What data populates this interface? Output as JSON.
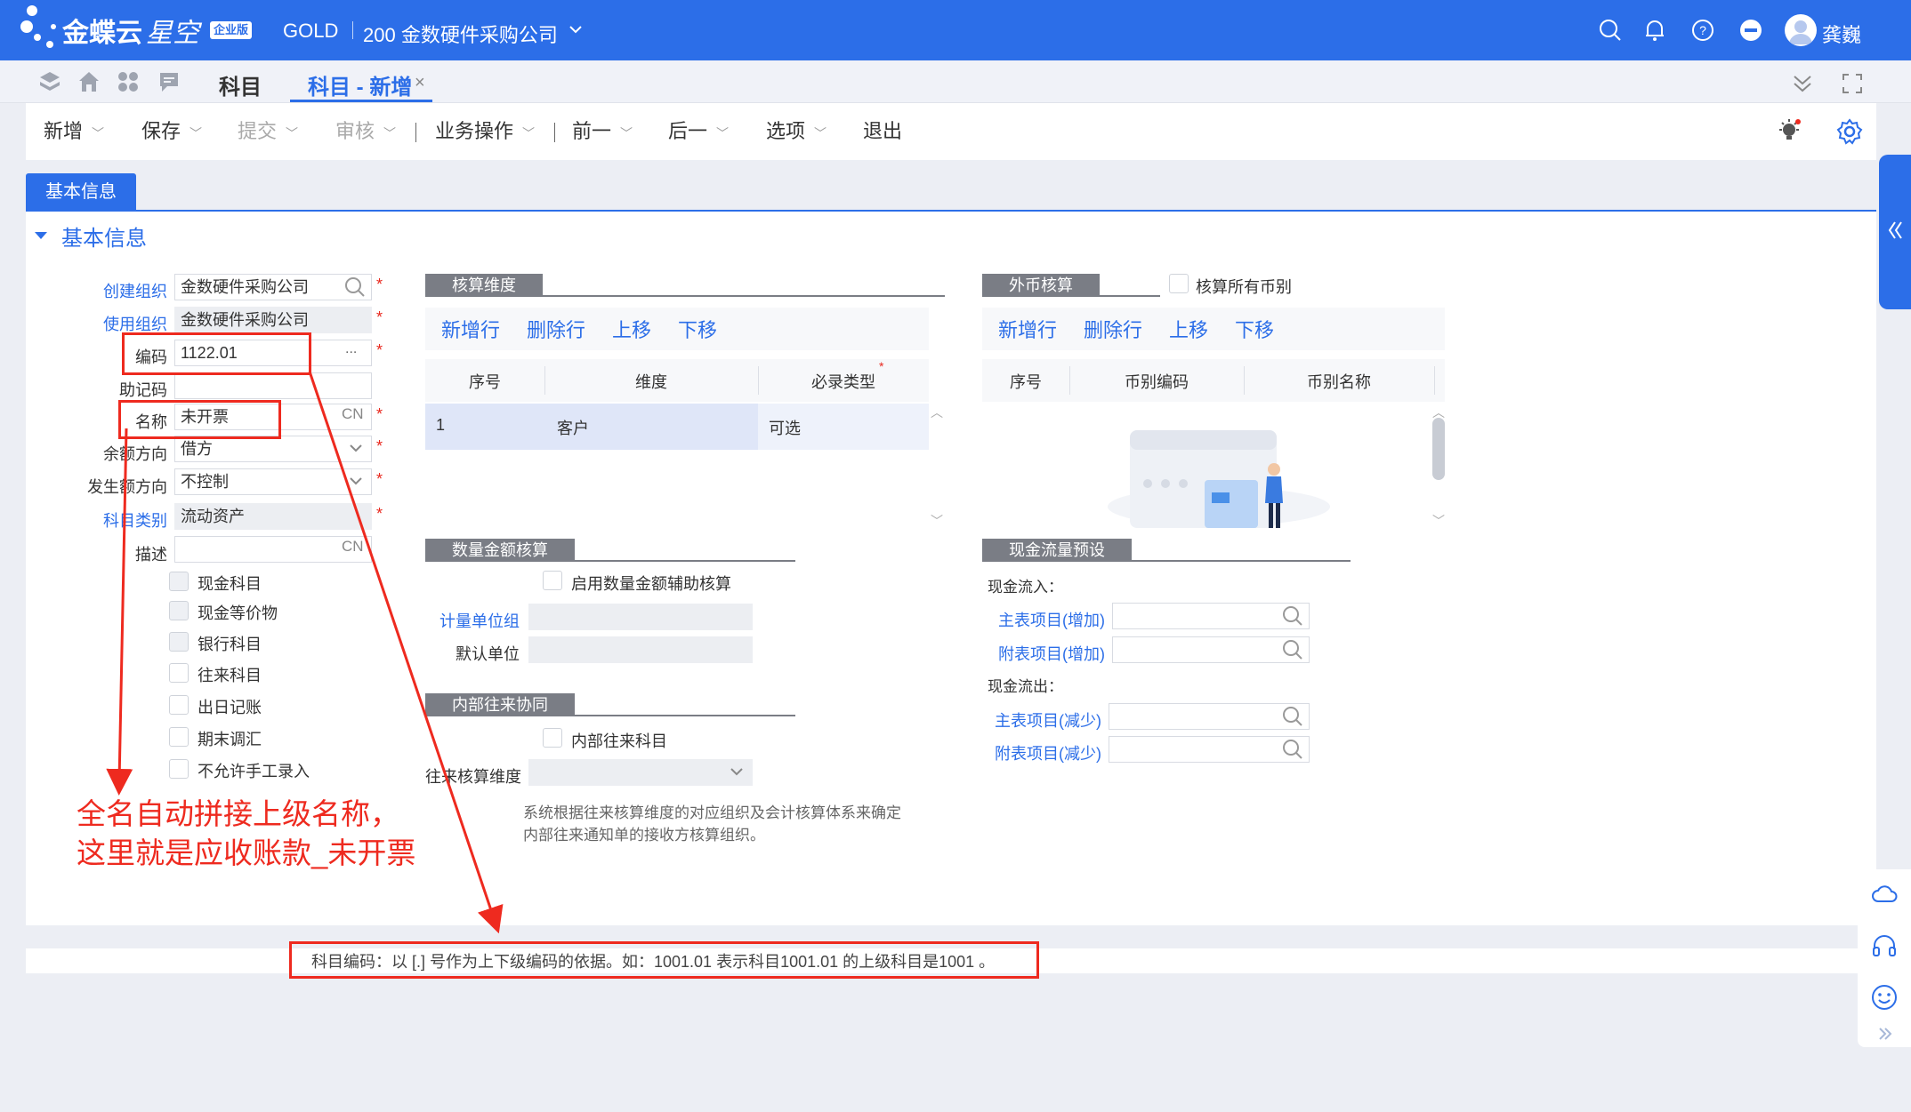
{
  "topbar": {
    "brand": "金蝶云",
    "brand_sub": "星空",
    "edition": "企业版",
    "tenant": "GOLD",
    "org": "200 金数硬件采购公司",
    "user": "龚巍"
  },
  "tabs": {
    "home_tab": "科目",
    "active_tab": "科目 - 新增"
  },
  "toolbar": {
    "new": "新增",
    "save": "保存",
    "submit": "提交",
    "audit": "审核",
    "business": "业务操作",
    "prev": "前一",
    "next": "后一",
    "options": "选项",
    "exit": "退出"
  },
  "form": {
    "tab_label": "基本信息",
    "section_title": "基本信息",
    "create_org_label": "创建组织",
    "create_org_value": "金数硬件采购公司",
    "use_org_label": "使用组织",
    "use_org_value": "金数硬件采购公司",
    "code_label": "编码",
    "code_value": "1122.01",
    "code_more": "...",
    "mnemonic_label": "助记码",
    "name_label": "名称",
    "name_value": "未开票",
    "lang_tag": "CN",
    "balance_dir_label": "余额方向",
    "balance_dir_value": "借方",
    "occur_dir_label": "发生额方向",
    "occur_dir_value": "不控制",
    "category_label": "科目类别",
    "category_value": "流动资产",
    "desc_label": "描述",
    "desc_lang_tag": "CN",
    "checkboxes": [
      "现金科目",
      "现金等价物",
      "银行科目",
      "往来科目",
      "出日记账",
      "期末调汇",
      "不允许手工录入"
    ]
  },
  "dims": {
    "title": "核算维度",
    "add_row": "新增行",
    "del_row": "删除行",
    "move_up": "上移",
    "move_down": "下移",
    "columns": [
      "序号",
      "维度",
      "必录类型"
    ],
    "rows": [
      {
        "seq": "1",
        "dim": "客户",
        "type": "可选"
      }
    ]
  },
  "fx": {
    "title": "外币核算",
    "all_currency": "核算所有币别",
    "add_row": "新增行",
    "del_row": "删除行",
    "move_up": "上移",
    "move_down": "下移",
    "columns": [
      "序号",
      "币别编码",
      "币别名称"
    ]
  },
  "qty": {
    "title": "数量金额核算",
    "enable": "启用数量金额辅助核算",
    "unit_group_label": "计量单位组",
    "default_unit_label": "默认单位"
  },
  "interco": {
    "title": "内部往来协同",
    "account": "内部往来科目",
    "dim_label": "往来核算维度",
    "note_line1": "系统根据往来核算维度的对应组织及会计核算体系来确定",
    "note_line2": "内部往来通知单的接收方核算组织。"
  },
  "cashflow": {
    "title": "现金流量预设",
    "inflow": "现金流入：",
    "main_in": "主表项目(增加)",
    "sub_in": "附表项目(增加)",
    "outflow": "现金流出：",
    "main_out": "主表项目(减少)",
    "sub_out": "附表项目(减少)"
  },
  "footer": {
    "hint": "科目编码：以 [.] 号作为上下级编码的依据。如：1001.01 表示科目1001.01 的上级科目是1001 。"
  },
  "annotation": {
    "line1": "全名自动拼接上级名称，",
    "line2": "这里就是应收账款_未开票"
  },
  "colors": {
    "brand_blue": "#2c6ee8",
    "annotation_red": "#ee2a1f",
    "section_gray": "#7a7d85"
  }
}
